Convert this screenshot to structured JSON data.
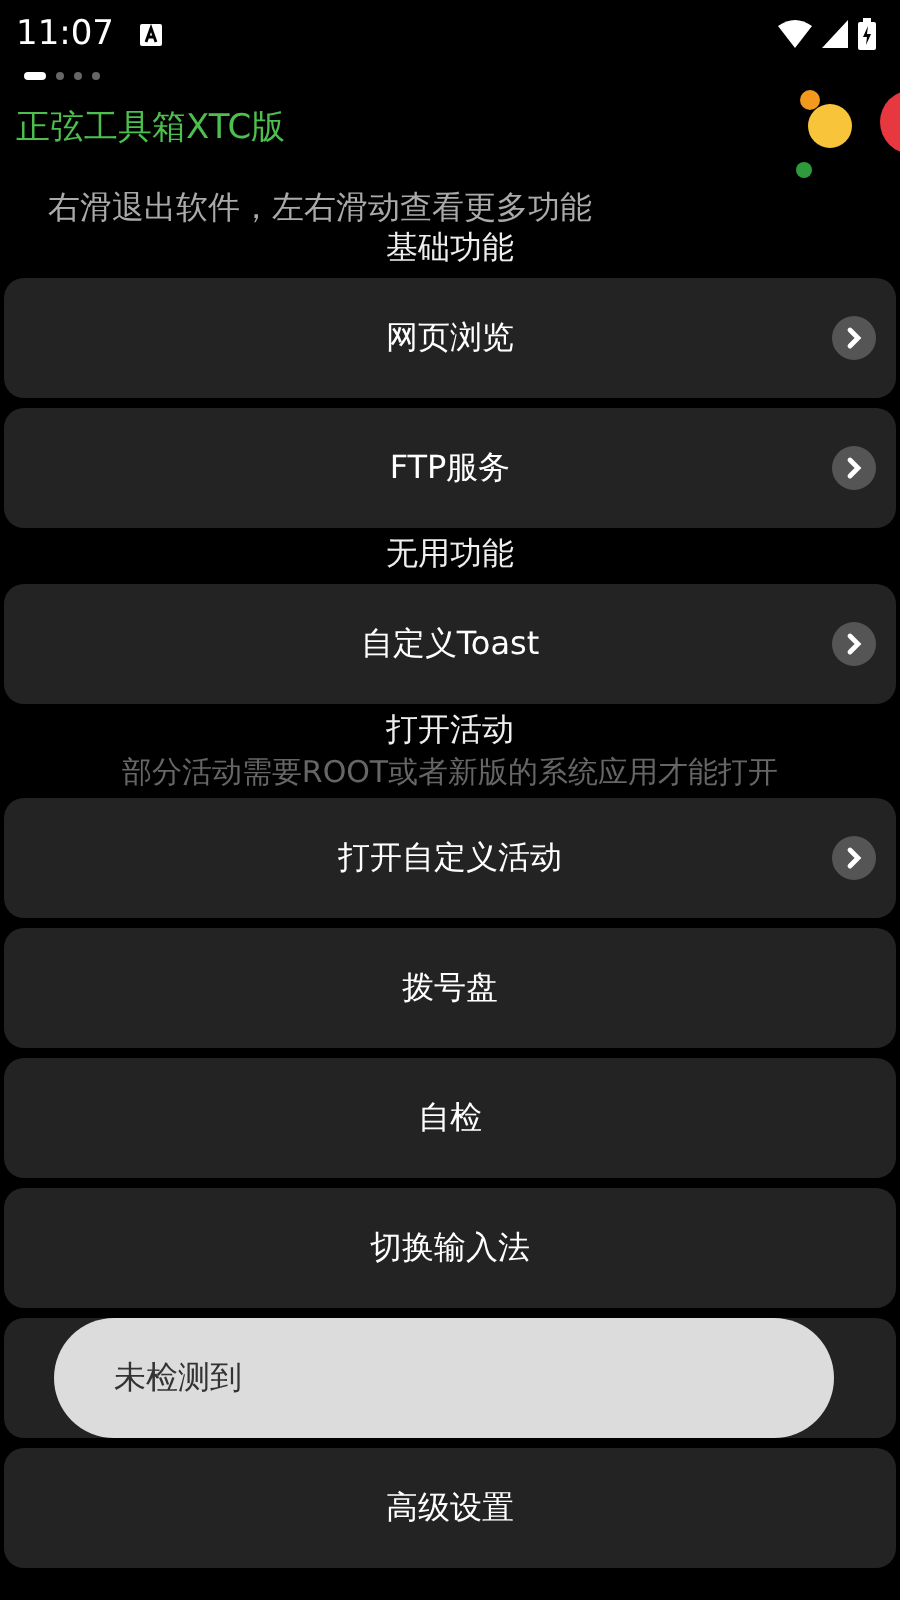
{
  "status_bar": {
    "time": "11:07"
  },
  "page_indicator": {
    "pages": [
      {
        "selected": true
      },
      {
        "selected": false
      },
      {
        "selected": false
      },
      {
        "selected": false
      }
    ]
  },
  "app_title": "正弦工具箱XTC版",
  "hint": "右滑退出软件，左右滑动查看更多功能",
  "items": [
    {
      "kind": "header",
      "text": "基础功能"
    },
    {
      "kind": "row",
      "text": "网页浏览",
      "chevron": true
    },
    {
      "kind": "row",
      "text": "FTP服务",
      "chevron": true
    },
    {
      "kind": "header",
      "text": "无用功能"
    },
    {
      "kind": "row",
      "text": "自定义Toast",
      "chevron": true
    },
    {
      "kind": "header",
      "text": "打开活动"
    },
    {
      "kind": "note",
      "text": "部分活动需要ROOT或者新版的系统应用才能打开"
    },
    {
      "kind": "row",
      "text": "打开自定义活动",
      "chevron": true
    },
    {
      "kind": "row",
      "text": "拨号盘",
      "chevron": false
    },
    {
      "kind": "row",
      "text": "自检",
      "chevron": false
    },
    {
      "kind": "row",
      "text": "切换输入法",
      "chevron": false
    },
    {
      "kind": "toast",
      "text": "未检测到"
    },
    {
      "kind": "row",
      "text": "高级设置",
      "chevron": false
    }
  ]
}
